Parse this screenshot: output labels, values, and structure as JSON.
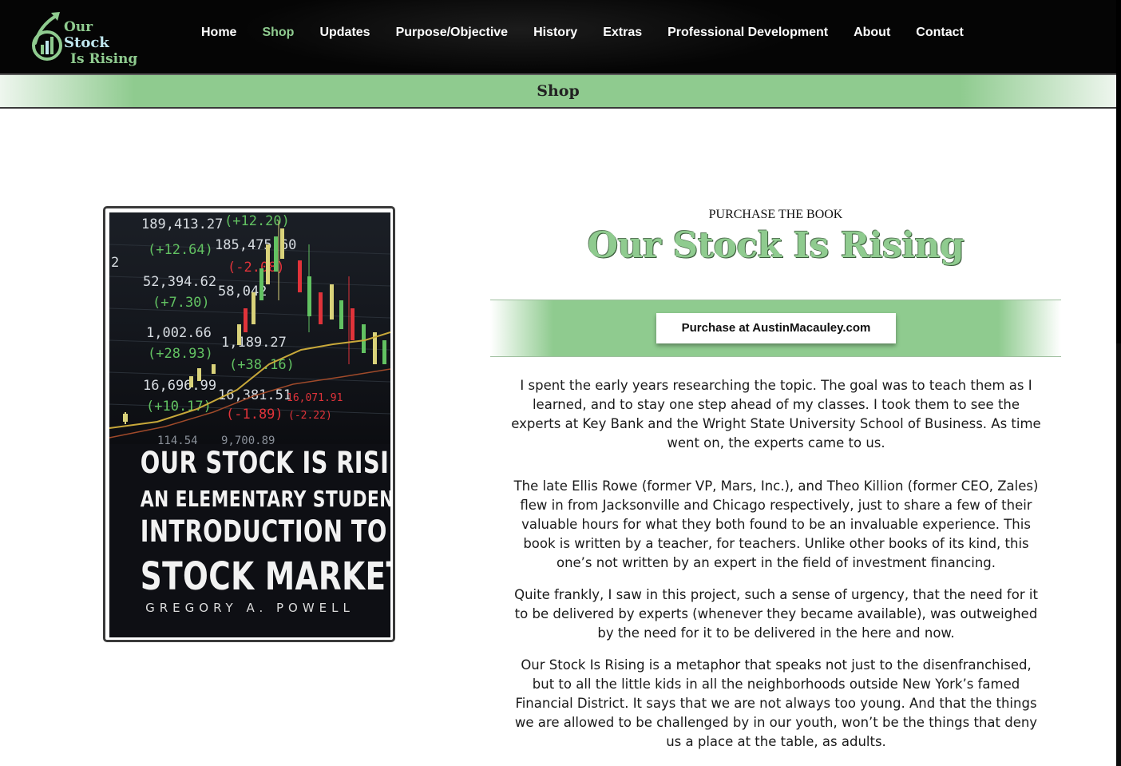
{
  "header": {
    "logo": {
      "line1_prefix": "Our",
      "line1_highlight": "Stock",
      "line2": "Is Rising"
    },
    "nav": [
      {
        "label": "Home",
        "name": "nav-home",
        "active": false
      },
      {
        "label": "Shop",
        "name": "nav-shop",
        "active": true
      },
      {
        "label": "Updates",
        "name": "nav-updates",
        "active": false
      },
      {
        "label": "Purpose/Objective",
        "name": "nav-purpose-objective",
        "active": false
      },
      {
        "label": "History",
        "name": "nav-history",
        "active": false
      },
      {
        "label": "Extras",
        "name": "nav-extras",
        "active": false
      },
      {
        "label": "Professional Development",
        "name": "nav-professional-development",
        "active": false
      },
      {
        "label": "About",
        "name": "nav-about",
        "active": false
      },
      {
        "label": "Contact",
        "name": "nav-contact",
        "active": false
      }
    ]
  },
  "page": {
    "title": "Shop"
  },
  "cover": {
    "title_lines": [
      "OUR STOCK IS RISING",
      "AN ELEMENTARY STUDENT’S",
      "INTRODUCTION TO THE",
      "STOCK MARKET"
    ],
    "author": "GREGORY A. POWELL",
    "ticker_numbers": [
      "189,413.27",
      "(+12.64)",
      "185,475.60",
      "(+12.20)",
      "52,394.62",
      "(+7.30)",
      "58,042",
      "(-2.08)",
      "1,002.66",
      "(+28.93)",
      "1,189.27",
      "(+38.16)",
      "16,696.99",
      "(+10.17)",
      "16,381.51",
      "(-1.89)",
      "16,071.91",
      "(-2.22)",
      "114.54",
      "9,700.89",
      "2"
    ]
  },
  "purchase": {
    "eyebrow": "PURCHASE THE BOOK",
    "title": "Our Stock Is Rising",
    "button_label": "Purchase at AustinMacauley.com"
  },
  "description": {
    "paragraphs": [
      "I spent the early years researching the topic. The goal was to teach them as I learned, and to stay one step ahead of my classes. I took them to see the experts at Key Bank and the Wright State University School of Business. As time went on, the experts came to us.",
      "The late Ellis Rowe (former VP, Mars, Inc.), and Theo Killion (former CEO, Zales) flew in from Jacksonville and Chicago respectively, just to share a few of their valuable hours for what they both found to be an invaluable experience. This book is written by a teacher, for teachers. Unlike other books of its kind, this one’s not written by an expert in the field of investment financing.",
      "Quite frankly, I saw in this project, such a sense of urgency, that the need for it to be delivered by experts (whenever they became available), was outweighed by the need for it to be delivered in the here and now.",
      "Our Stock Is Rising is a metaphor that speaks not just to the disenfranchised, but to all the little kids in all the neighborhoods outside New York’s famed Financial District. It says that we are not always too young. And that the things we are allowed to be challenged by in our youth, won’t be the things that deny us a place at the table, as adults."
    ]
  },
  "colors": {
    "accent": "#8fcb8f",
    "header_bg": "#050505",
    "up": "#62c262",
    "down": "#e0333a",
    "logo_highlight": "#bfe6ee"
  }
}
